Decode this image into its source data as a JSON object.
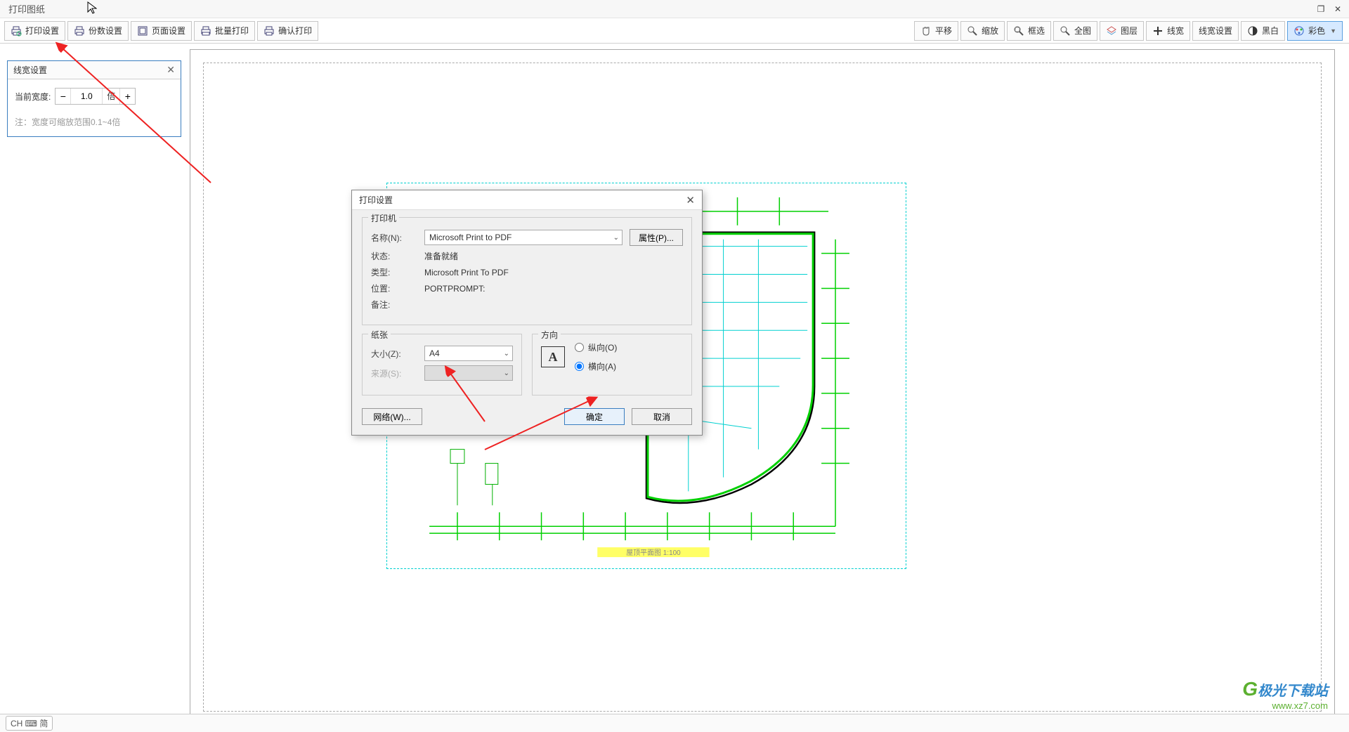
{
  "window": {
    "title": "打印图纸"
  },
  "toolbar": {
    "left": [
      {
        "label": "打印设置",
        "icon": "printer-gear"
      },
      {
        "label": "份数设置",
        "icon": "printer-copies"
      },
      {
        "label": "页面设置",
        "icon": "page"
      },
      {
        "label": "批量打印",
        "icon": "printer-batch"
      },
      {
        "label": "确认打印",
        "icon": "printer-check"
      }
    ],
    "right": [
      {
        "label": "平移",
        "icon": "hand"
      },
      {
        "label": "缩放",
        "icon": "zoom"
      },
      {
        "label": "框选",
        "icon": "zoom-rect"
      },
      {
        "label": "全图",
        "icon": "zoom-all"
      },
      {
        "label": "图层",
        "icon": "layers"
      },
      {
        "label": "线宽",
        "icon": "plus"
      },
      {
        "label": "线宽设置",
        "icon": "none"
      },
      {
        "label": "黑白",
        "icon": "bw"
      },
      {
        "label": "彩色",
        "icon": "color",
        "dropdown": true,
        "highlight": true
      }
    ]
  },
  "panel": {
    "title": "线宽设置",
    "current_label": "当前宽度:",
    "value": "1.0",
    "unit": "倍",
    "note": "注：宽度可缩放范围0.1~4倍"
  },
  "dialog": {
    "title": "打印设置",
    "printer": {
      "legend": "打印机",
      "name_label": "名称(N):",
      "name_value": "Microsoft Print to PDF",
      "properties": "属性(P)...",
      "status_label": "状态:",
      "status_value": "准备就绪",
      "type_label": "类型:",
      "type_value": "Microsoft Print To PDF",
      "where_label": "位置:",
      "where_value": "PORTPROMPT:",
      "comment_label": "备注:"
    },
    "paper": {
      "legend": "纸张",
      "size_label": "大小(Z):",
      "size_value": "A4",
      "source_label": "来源(S):"
    },
    "orient": {
      "legend": "方向",
      "portrait": "纵向(O)",
      "landscape": "横向(A)",
      "selected": "landscape"
    },
    "buttons": {
      "network": "网络(W)...",
      "ok": "确定",
      "cancel": "取消"
    }
  },
  "drawing": {
    "caption": "屋顶平面图  1:100"
  },
  "statusbar": {
    "ime": "CH ⌨ 简"
  },
  "watermark": {
    "brand": "极光下载站",
    "url": "www.xz7.com"
  }
}
